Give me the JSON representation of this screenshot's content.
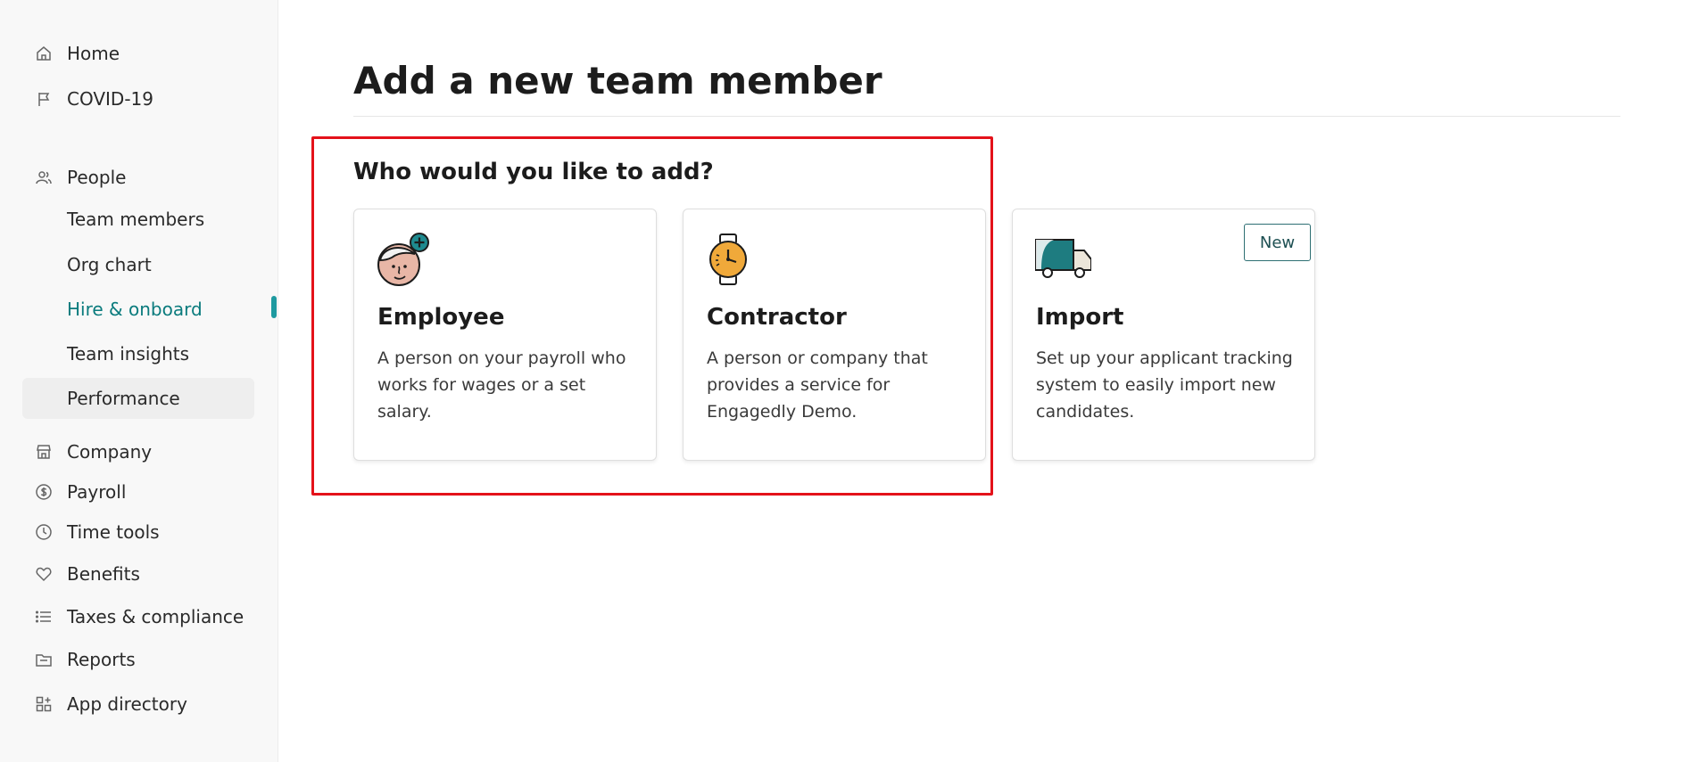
{
  "sidebar": {
    "items": [
      {
        "label": "Home",
        "icon": "home-icon"
      },
      {
        "label": "COVID-19",
        "icon": "flag-icon"
      },
      {
        "label": "People",
        "icon": "people-icon"
      },
      {
        "label": "Team members"
      },
      {
        "label": "Org chart"
      },
      {
        "label": "Hire & onboard",
        "state": "active"
      },
      {
        "label": "Team insights"
      },
      {
        "label": "Performance",
        "state": "hovered"
      },
      {
        "label": "Company",
        "icon": "store-icon"
      },
      {
        "label": "Payroll",
        "icon": "dollar-icon"
      },
      {
        "label": "Time tools",
        "icon": "clock-icon"
      },
      {
        "label": "Benefits",
        "icon": "heart-icon"
      },
      {
        "label": "Taxes & compliance",
        "icon": "list-icon"
      },
      {
        "label": "Reports",
        "icon": "folder-icon"
      },
      {
        "label": "App directory",
        "icon": "apps-icon"
      }
    ]
  },
  "main": {
    "title": "Add a new team member",
    "question": "Who would you like to add?",
    "cards": [
      {
        "title": "Employee",
        "description": "A person on your payroll who works for wages or a set salary.",
        "icon": "employee-illustration"
      },
      {
        "title": "Contractor",
        "description": "A person or company that provides a service for Engagedly Demo.",
        "icon": "watch-illustration"
      },
      {
        "title": "Import",
        "description": "Set up your applicant tracking system to easily import new candidates.",
        "icon": "truck-illustration",
        "badge": "New"
      }
    ]
  },
  "colors": {
    "accent": "#0a7b7d",
    "active_bar": "#1e9aa0",
    "highlight": "#e4121a"
  }
}
